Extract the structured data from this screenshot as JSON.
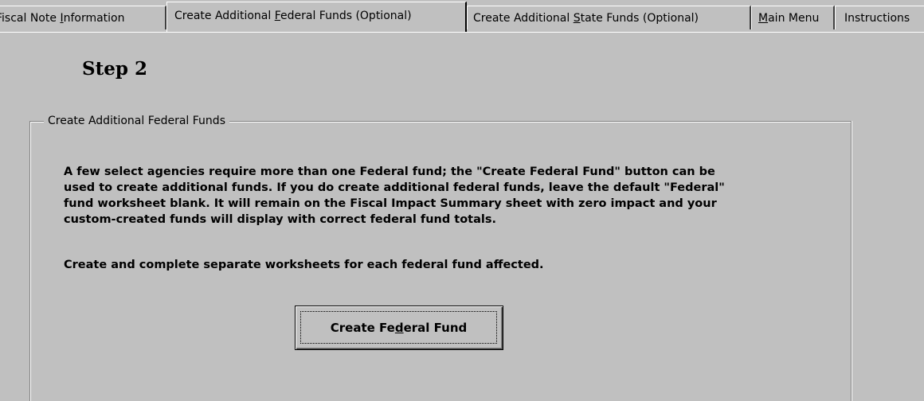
{
  "tabs": [
    {
      "pre": "Fiscal Note ",
      "accel": "I",
      "post": "nformation",
      "active": false
    },
    {
      "pre": "Create Additional ",
      "accel": "F",
      "post": "ederal Funds (Optional)",
      "active": true
    },
    {
      "pre": "Create Additional ",
      "accel": "S",
      "post": "tate Funds (Optional)",
      "active": false
    },
    {
      "pre": "",
      "accel": "M",
      "post": "ain Menu",
      "active": false
    },
    {
      "pre": "Instructions",
      "accel": "",
      "post": "",
      "active": false
    }
  ],
  "step_title": "Step 2",
  "groupbox": {
    "legend": "Create Additional Federal Funds",
    "paragraph1": "A few select agencies require more than one Federal fund; the \"Create Federal Fund\" button can be\nused to create additional funds.  If you do create additional federal funds, leave the default \"Federal\"\nfund worksheet blank.  It will remain on the Fiscal Impact Summary sheet with zero impact and your\ncustom-created funds will display with correct federal fund totals.",
    "paragraph2": "Create and complete separate worksheets for each federal fund affected.",
    "button": {
      "pre": "Create Fe",
      "accel": "d",
      "post": "eral Fund"
    }
  }
}
